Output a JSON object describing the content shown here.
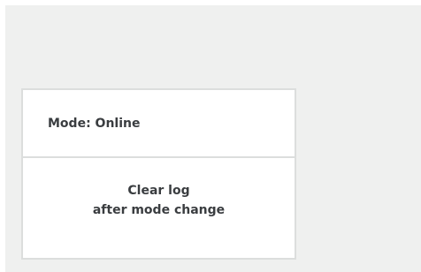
{
  "panel": {
    "mode_label": "Mode: Online",
    "clear_line1": "Clear log",
    "clear_line2": "after mode change"
  }
}
